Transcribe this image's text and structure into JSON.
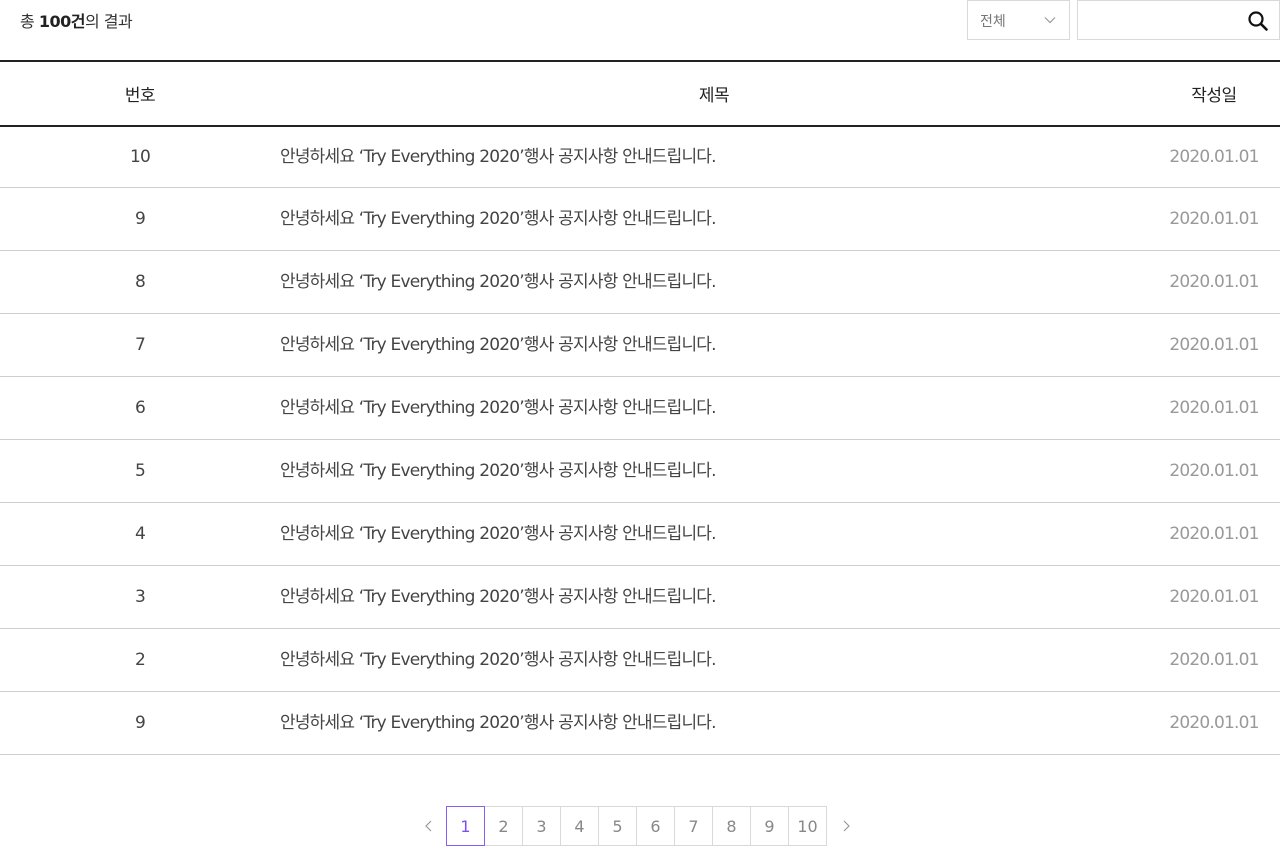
{
  "summary": {
    "prefix": "총 ",
    "count": "100건",
    "suffix": "의 결과"
  },
  "filter": {
    "selected": "전체"
  },
  "search": {
    "value": "",
    "placeholder": ""
  },
  "table": {
    "headers": {
      "number": "번호",
      "title": "제목",
      "date": "작성일"
    },
    "rows": [
      {
        "number": "10",
        "title": "안녕하세요 ‘Try Everything 2020’행사 공지사항 안내드립니다.",
        "date": "2020.01.01"
      },
      {
        "number": "9",
        "title": "안녕하세요 ‘Try Everything 2020’행사 공지사항 안내드립니다.",
        "date": "2020.01.01"
      },
      {
        "number": "8",
        "title": "안녕하세요 ‘Try Everything 2020’행사 공지사항 안내드립니다.",
        "date": "2020.01.01"
      },
      {
        "number": "7",
        "title": "안녕하세요 ‘Try Everything 2020’행사 공지사항 안내드립니다.",
        "date": "2020.01.01"
      },
      {
        "number": "6",
        "title": "안녕하세요 ‘Try Everything 2020’행사 공지사항 안내드립니다.",
        "date": "2020.01.01"
      },
      {
        "number": "5",
        "title": "안녕하세요 ‘Try Everything 2020’행사 공지사항 안내드립니다.",
        "date": "2020.01.01"
      },
      {
        "number": "4",
        "title": "안녕하세요 ‘Try Everything 2020’행사 공지사항 안내드립니다.",
        "date": "2020.01.01"
      },
      {
        "number": "3",
        "title": "안녕하세요 ‘Try Everything 2020’행사 공지사항 안내드립니다.",
        "date": "2020.01.01"
      },
      {
        "number": "2",
        "title": "안녕하세요 ‘Try Everything 2020’행사 공지사항 안내드립니다.",
        "date": "2020.01.01"
      },
      {
        "number": "9",
        "title": "안녕하세요 ‘Try Everything 2020’행사 공지사항 안내드립니다.",
        "date": "2020.01.01"
      }
    ]
  },
  "pagination": {
    "pages": [
      "1",
      "2",
      "3",
      "4",
      "5",
      "6",
      "7",
      "8",
      "9",
      "10"
    ],
    "active": "1",
    "prev_icon": "chevron-left-icon",
    "next_icon": "chevron-right-icon"
  },
  "colors": {
    "accent": "#7b4ff0",
    "border": "#d9d9d9",
    "header_line": "#222222",
    "date_text": "#999999"
  }
}
